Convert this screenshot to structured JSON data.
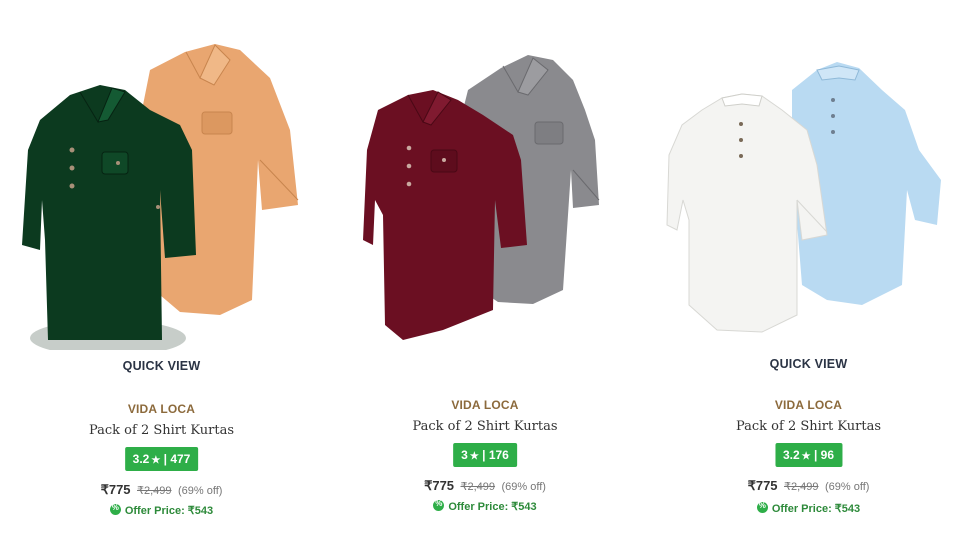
{
  "products": [
    {
      "quick_view": "QUICK VIEW",
      "brand": "VIDA LOCA",
      "name": "Pack of 2 Shirt Kurtas",
      "rating": "3.2",
      "rating_count": "477",
      "price": "₹775",
      "mrp": "₹2,499",
      "discount": "(69% off)",
      "offer_price": "Offer Price: ₹543",
      "image": "shirt-pack-green-peach",
      "colors": [
        "#0c3a1f",
        "#e9a670"
      ]
    },
    {
      "quick_view": "",
      "brand": "VIDA LOCA",
      "name": "Pack of 2 Shirt Kurtas",
      "rating": "3",
      "rating_count": "176",
      "price": "₹775",
      "mrp": "₹2,499",
      "discount": "(69% off)",
      "offer_price": "Offer Price: ₹543",
      "image": "shirt-pack-maroon-grey",
      "colors": [
        "#6b0f22",
        "#8a8a8e"
      ]
    },
    {
      "quick_view": "QUICK VIEW",
      "brand": "VIDA LOCA",
      "name": "Pack of 2 Shirt Kurtas",
      "rating": "3.2",
      "rating_count": "96",
      "price": "₹775",
      "mrp": "₹2,499",
      "discount": "(69% off)",
      "offer_price": "Offer Price: ₹543",
      "image": "shirt-pack-white-skyblue",
      "colors": [
        "#f4f4f2",
        "#b9daf2"
      ]
    }
  ],
  "icons": {
    "star": "star-icon",
    "offer": "offer-badge-icon"
  }
}
